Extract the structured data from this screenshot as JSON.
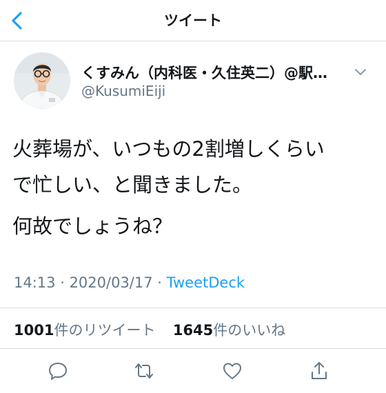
{
  "nav": {
    "title": "ツイート",
    "back_icon": "chevron-left-icon"
  },
  "author": {
    "display_name": "くすみん（内科医・久住英二）@駅…",
    "handle": "@KusumiEiji",
    "avatar": "avatar"
  },
  "tweet": {
    "line1": "火葬場が、いつもの2割増しくらい",
    "line2": "で忙しい、と聞きました。",
    "line3": "何故でしょうね？"
  },
  "meta": {
    "time": "14:13",
    "sep1": " · ",
    "date": "2020/03/17",
    "sep2": " · ",
    "source": "TweetDeck"
  },
  "stats": {
    "retweet_count": "1001",
    "retweet_label": "件のリツイート",
    "like_count": "1645",
    "like_label": "件のいいね"
  },
  "actions": {
    "reply_icon": "reply-icon",
    "retweet_icon": "retweet-icon",
    "like_icon": "heart-icon",
    "share_icon": "share-icon"
  },
  "colors": {
    "accent": "#1da1f2",
    "secondary_text": "#657786",
    "primary_text": "#14171a",
    "divider": "#d8dde2"
  }
}
